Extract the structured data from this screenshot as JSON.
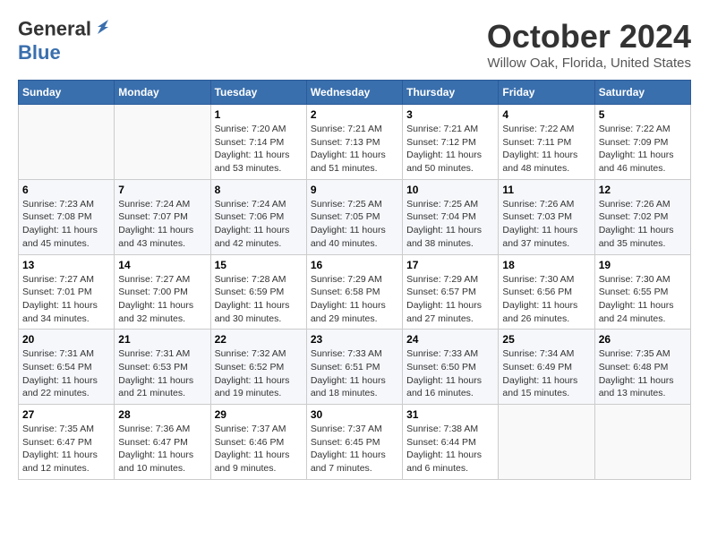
{
  "header": {
    "logo_general": "General",
    "logo_blue": "Blue",
    "month": "October 2024",
    "location": "Willow Oak, Florida, United States"
  },
  "days_of_week": [
    "Sunday",
    "Monday",
    "Tuesday",
    "Wednesday",
    "Thursday",
    "Friday",
    "Saturday"
  ],
  "weeks": [
    [
      {
        "day": "",
        "text": ""
      },
      {
        "day": "",
        "text": ""
      },
      {
        "day": "1",
        "text": "Sunrise: 7:20 AM\nSunset: 7:14 PM\nDaylight: 11 hours and 53 minutes."
      },
      {
        "day": "2",
        "text": "Sunrise: 7:21 AM\nSunset: 7:13 PM\nDaylight: 11 hours and 51 minutes."
      },
      {
        "day": "3",
        "text": "Sunrise: 7:21 AM\nSunset: 7:12 PM\nDaylight: 11 hours and 50 minutes."
      },
      {
        "day": "4",
        "text": "Sunrise: 7:22 AM\nSunset: 7:11 PM\nDaylight: 11 hours and 48 minutes."
      },
      {
        "day": "5",
        "text": "Sunrise: 7:22 AM\nSunset: 7:09 PM\nDaylight: 11 hours and 46 minutes."
      }
    ],
    [
      {
        "day": "6",
        "text": "Sunrise: 7:23 AM\nSunset: 7:08 PM\nDaylight: 11 hours and 45 minutes."
      },
      {
        "day": "7",
        "text": "Sunrise: 7:24 AM\nSunset: 7:07 PM\nDaylight: 11 hours and 43 minutes."
      },
      {
        "day": "8",
        "text": "Sunrise: 7:24 AM\nSunset: 7:06 PM\nDaylight: 11 hours and 42 minutes."
      },
      {
        "day": "9",
        "text": "Sunrise: 7:25 AM\nSunset: 7:05 PM\nDaylight: 11 hours and 40 minutes."
      },
      {
        "day": "10",
        "text": "Sunrise: 7:25 AM\nSunset: 7:04 PM\nDaylight: 11 hours and 38 minutes."
      },
      {
        "day": "11",
        "text": "Sunrise: 7:26 AM\nSunset: 7:03 PM\nDaylight: 11 hours and 37 minutes."
      },
      {
        "day": "12",
        "text": "Sunrise: 7:26 AM\nSunset: 7:02 PM\nDaylight: 11 hours and 35 minutes."
      }
    ],
    [
      {
        "day": "13",
        "text": "Sunrise: 7:27 AM\nSunset: 7:01 PM\nDaylight: 11 hours and 34 minutes."
      },
      {
        "day": "14",
        "text": "Sunrise: 7:27 AM\nSunset: 7:00 PM\nDaylight: 11 hours and 32 minutes."
      },
      {
        "day": "15",
        "text": "Sunrise: 7:28 AM\nSunset: 6:59 PM\nDaylight: 11 hours and 30 minutes."
      },
      {
        "day": "16",
        "text": "Sunrise: 7:29 AM\nSunset: 6:58 PM\nDaylight: 11 hours and 29 minutes."
      },
      {
        "day": "17",
        "text": "Sunrise: 7:29 AM\nSunset: 6:57 PM\nDaylight: 11 hours and 27 minutes."
      },
      {
        "day": "18",
        "text": "Sunrise: 7:30 AM\nSunset: 6:56 PM\nDaylight: 11 hours and 26 minutes."
      },
      {
        "day": "19",
        "text": "Sunrise: 7:30 AM\nSunset: 6:55 PM\nDaylight: 11 hours and 24 minutes."
      }
    ],
    [
      {
        "day": "20",
        "text": "Sunrise: 7:31 AM\nSunset: 6:54 PM\nDaylight: 11 hours and 22 minutes."
      },
      {
        "day": "21",
        "text": "Sunrise: 7:31 AM\nSunset: 6:53 PM\nDaylight: 11 hours and 21 minutes."
      },
      {
        "day": "22",
        "text": "Sunrise: 7:32 AM\nSunset: 6:52 PM\nDaylight: 11 hours and 19 minutes."
      },
      {
        "day": "23",
        "text": "Sunrise: 7:33 AM\nSunset: 6:51 PM\nDaylight: 11 hours and 18 minutes."
      },
      {
        "day": "24",
        "text": "Sunrise: 7:33 AM\nSunset: 6:50 PM\nDaylight: 11 hours and 16 minutes."
      },
      {
        "day": "25",
        "text": "Sunrise: 7:34 AM\nSunset: 6:49 PM\nDaylight: 11 hours and 15 minutes."
      },
      {
        "day": "26",
        "text": "Sunrise: 7:35 AM\nSunset: 6:48 PM\nDaylight: 11 hours and 13 minutes."
      }
    ],
    [
      {
        "day": "27",
        "text": "Sunrise: 7:35 AM\nSunset: 6:47 PM\nDaylight: 11 hours and 12 minutes."
      },
      {
        "day": "28",
        "text": "Sunrise: 7:36 AM\nSunset: 6:47 PM\nDaylight: 11 hours and 10 minutes."
      },
      {
        "day": "29",
        "text": "Sunrise: 7:37 AM\nSunset: 6:46 PM\nDaylight: 11 hours and 9 minutes."
      },
      {
        "day": "30",
        "text": "Sunrise: 7:37 AM\nSunset: 6:45 PM\nDaylight: 11 hours and 7 minutes."
      },
      {
        "day": "31",
        "text": "Sunrise: 7:38 AM\nSunset: 6:44 PM\nDaylight: 11 hours and 6 minutes."
      },
      {
        "day": "",
        "text": ""
      },
      {
        "day": "",
        "text": ""
      }
    ]
  ]
}
